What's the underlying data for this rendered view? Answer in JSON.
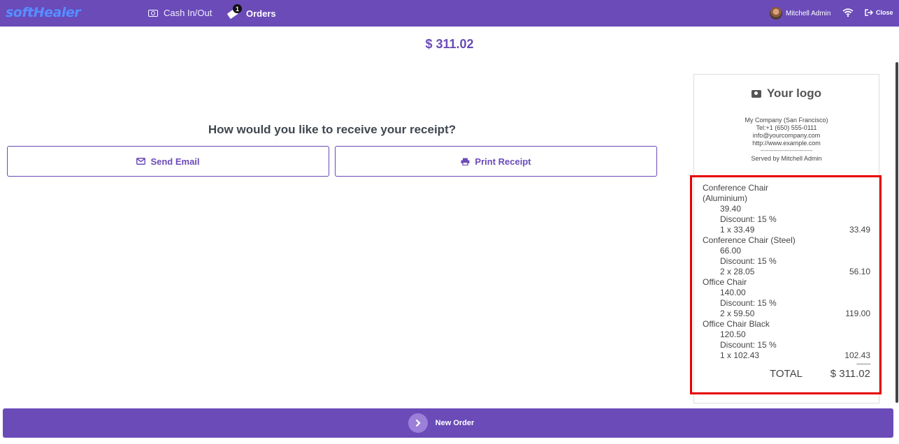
{
  "topbar": {
    "brand": "softHealer",
    "cash_label": "Cash In/Out",
    "orders_label": "Orders",
    "orders_badge": "1",
    "user_name": "Mitchell Admin",
    "close_label": "Close",
    "color": "#6a4bb8"
  },
  "payment": {
    "amount": "$ 311.02"
  },
  "receipt_choice": {
    "question": "How would you like to receive your receipt?",
    "email_label": "Send Email",
    "print_label": "Print Receipt"
  },
  "receipt": {
    "logo_text": "Your logo",
    "company": "My Company (San Francisco)",
    "phone": "Tel:+1 (650) 555-0111",
    "email": "info@yourcompany.com",
    "website": "http://www.example.com",
    "separator": "--------------------------------",
    "served_by": "Served by Mitchell Admin",
    "items": [
      {
        "name": "Conference Chair",
        "name2": "(Aluminium)",
        "price": "39.40",
        "discount": "Discount: 15 %",
        "qty_line": "1 x 33.49",
        "subtotal": "33.49"
      },
      {
        "name": "Conference Chair (Steel)",
        "price": "66.00",
        "discount": "Discount: 15 %",
        "qty_line": "2 x 28.05",
        "subtotal": "56.10"
      },
      {
        "name": "Office Chair",
        "price": "140.00",
        "discount": "Discount: 15 %",
        "qty_line": "2 x 59.50",
        "subtotal": "119.00"
      },
      {
        "name": "Office Chair Black",
        "price": "120.50",
        "discount": "Discount: 15 %",
        "qty_line": "1 x 102.43",
        "subtotal": "102.43"
      }
    ],
    "dashes": "--------",
    "total_label": "TOTAL",
    "total_value": "$ 311.02"
  },
  "bottom": {
    "new_order_label": "New Order"
  },
  "colors": {
    "accent": "#6a4bb8",
    "highlight": "#e60000"
  }
}
